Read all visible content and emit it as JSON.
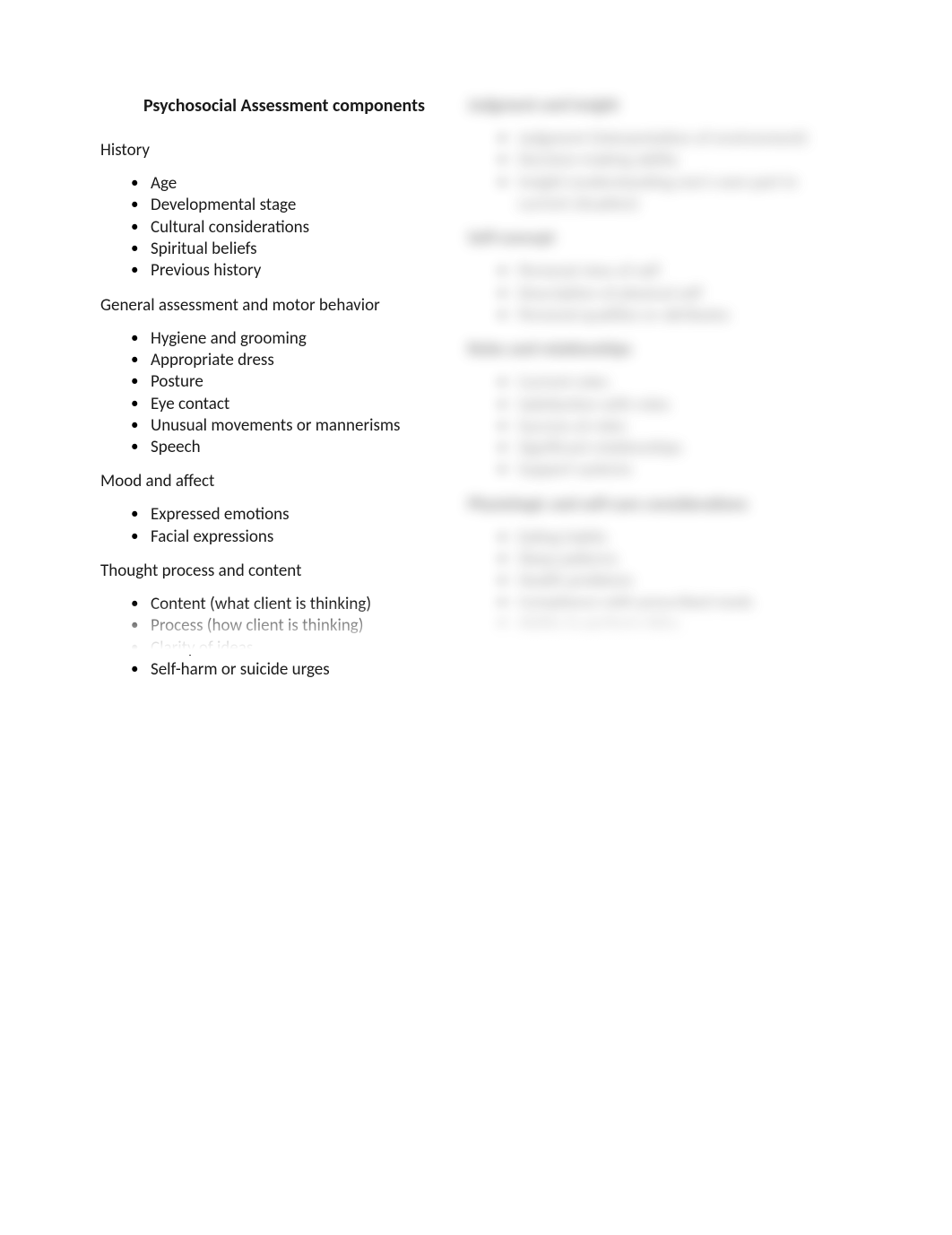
{
  "title": "Psychosocial Assessment components",
  "left": {
    "sections": [
      {
        "heading": "History",
        "items": [
          "Age",
          "Developmental stage",
          "Cultural considerations",
          "Spiritual beliefs",
          "Previous history"
        ]
      },
      {
        "heading": "General assessment and motor behavior",
        "items": [
          "Hygiene and grooming",
          "Appropriate dress",
          "Posture",
          "Eye contact",
          "Unusual movements or mannerisms",
          "Speech"
        ]
      },
      {
        "heading": "Mood and affect",
        "items": [
          "Expressed emotions",
          "Facial expressions"
        ]
      },
      {
        "heading": "Thought process and content",
        "items": [
          "Content (what client is thinking)",
          "Process (how client is thinking)",
          "Clarity of ideas",
          "Self-harm or suicide urges"
        ]
      }
    ]
  },
  "right": {
    "sections": [
      {
        "heading": "Judgment and insight",
        "items": [
          "Judgment (interpretation of environment)",
          "Decision-making ability",
          "Insight (understanding one's own part in current situation)"
        ]
      },
      {
        "heading": "Self-concept",
        "items": [
          "Personal view of self",
          "Description of physical self",
          "Personal qualities or attributes"
        ]
      },
      {
        "heading": "Roles and relationships",
        "items": [
          "Current roles",
          "Satisfaction with roles",
          "Success at roles",
          "Significant relationships",
          "Support systems"
        ]
      },
      {
        "heading": "Physiologic and self-care considerations",
        "items": [
          "Eating habits",
          "Sleep patterns",
          "Health problems",
          "Compliance with prescribed meds",
          "Ability to perform ADLs"
        ]
      }
    ]
  }
}
